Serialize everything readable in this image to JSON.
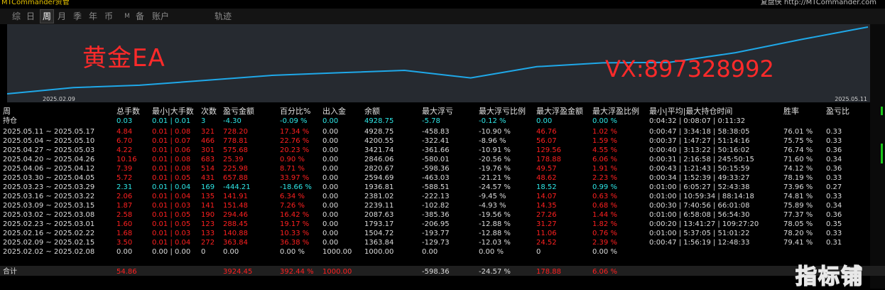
{
  "topbar": {
    "left": "MTCommander资管",
    "right": "复盘侠 http://MTCommander.com"
  },
  "tabs": [
    "综",
    "日",
    "周",
    "月",
    "季",
    "年",
    "币",
    "M",
    "备",
    "账户",
    "轨迹"
  ],
  "active_tab": "周",
  "chart": {
    "watermark_title": "黄金EA",
    "watermark_contact": "VX:897328992",
    "date_left": "2025.02.09",
    "date_right": "2025.05.11",
    "line_color": "#1fa8e8"
  },
  "headers": [
    "周",
    "总手数",
    "最小|大手数",
    "次数",
    "盈亏金额",
    "百分比%",
    "出入金",
    "余额",
    "最大浮亏",
    "最大浮亏比例",
    "最大浮盈金额",
    "最大浮盈比例",
    "最小|平均|最大持仓时间",
    "胜率",
    "盈亏比"
  ],
  "holding": {
    "label": "持仓",
    "lots": "0.03",
    "minmax": "0.01 | 0.01",
    "count": "3",
    "pnl": "-4.30",
    "pct": "-0.09 %",
    "flow": "0.00",
    "balance": "4928.75",
    "maxdd": "-5.78",
    "maxddpct": "-0.12 %",
    "maxfp": "0.00",
    "maxfppct": "0.00 %",
    "hold": "0:04:32 | 0:08:07 | 0:11:32",
    "win": "",
    "ratio": ""
  },
  "rows": [
    {
      "week": "2025.05.11 ~ 2025.05.17",
      "lots": "4.84",
      "minmax": "0.01 | 0.08",
      "count": "321",
      "pnl": "728.20",
      "pct": "17.34 %",
      "flow": "0.00",
      "balance": "4928.75",
      "maxdd": "-458.83",
      "maxddpct": "-10.90 %",
      "maxfp": "46.76",
      "maxfppct": "1.02 %",
      "hold": "0:00:47 | 3:34:18 | 58:38:05",
      "win": "76.01 %",
      "ratio": "0.33",
      "tone": "red"
    },
    {
      "week": "2025.05.04 ~ 2025.05.10",
      "lots": "6.70",
      "minmax": "0.01 | 0.07",
      "count": "466",
      "pnl": "778.81",
      "pct": "22.76 %",
      "flow": "0.00",
      "balance": "4200.55",
      "maxdd": "-322.41",
      "maxddpct": "-8.96 %",
      "maxfp": "56.07",
      "maxfppct": "1.59 %",
      "hold": "0:00:37 | 1:47:27 | 51:14:16",
      "win": "75.75 %",
      "ratio": "0.33",
      "tone": "red"
    },
    {
      "week": "2025.04.27 ~ 2025.05.03",
      "lots": "4.22",
      "minmax": "0.01 | 0.06",
      "count": "301",
      "pnl": "575.68",
      "pct": "20.23 %",
      "flow": "0.00",
      "balance": "3421.74",
      "maxdd": "-361.66",
      "maxddpct": "-10.91 %",
      "maxfp": "129.56",
      "maxfppct": "4.55 %",
      "hold": "0:00:40 | 3:13:22 | 50:16:02",
      "win": "76.74 %",
      "ratio": "0.36",
      "tone": "red"
    },
    {
      "week": "2025.04.20 ~ 2025.04.26",
      "lots": "10.16",
      "minmax": "0.01 | 0.08",
      "count": "683",
      "pnl": "25.39",
      "pct": "0.90 %",
      "flow": "0.00",
      "balance": "2846.06",
      "maxdd": "-580.01",
      "maxddpct": "-20.56 %",
      "maxfp": "178.88",
      "maxfppct": "6.06 %",
      "hold": "0:00:31 | 2:16:58 | 245:50:15",
      "win": "71.60 %",
      "ratio": "0.34",
      "tone": "red"
    },
    {
      "week": "2025.04.06 ~ 2025.04.12",
      "lots": "7.39",
      "minmax": "0.01 | 0.08",
      "count": "514",
      "pnl": "225.98",
      "pct": "8.71 %",
      "flow": "0.00",
      "balance": "2820.67",
      "maxdd": "-598.36",
      "maxddpct": "-19.76 %",
      "maxfp": "49.57",
      "maxfppct": "1.91 %",
      "hold": "0:00:43 | 1:21:43 | 50:15:59",
      "win": "74.12 %",
      "ratio": "0.36",
      "tone": "red"
    },
    {
      "week": "2025.03.30 ~ 2025.04.05",
      "lots": "5.72",
      "minmax": "0.01 | 0.05",
      "count": "431",
      "pnl": "657.88",
      "pct": "33.97 %",
      "flow": "0.00",
      "balance": "2594.69",
      "maxdd": "-463.03",
      "maxddpct": "-21.21 %",
      "maxfp": "48.62",
      "maxfppct": "2.23 %",
      "hold": "0:00:34 | 1:52:39 | 49:33:27",
      "win": "78.19 %",
      "ratio": "0.33",
      "tone": "red"
    },
    {
      "week": "2025.03.23 ~ 2025.03.29",
      "lots": "2.31",
      "minmax": "0.01 | 0.04",
      "count": "169",
      "pnl": "-444.21",
      "pct": "-18.66 %",
      "flow": "0.00",
      "balance": "1936.81",
      "maxdd": "-588.51",
      "maxddpct": "-24.57 %",
      "maxfp": "18.52",
      "maxfppct": "0.99 %",
      "hold": "0:01:00 | 6:05:27 | 52:43:38",
      "win": "73.96 %",
      "ratio": "0.27",
      "tone": "cyan"
    },
    {
      "week": "2025.03.16 ~ 2025.03.22",
      "lots": "2.06",
      "minmax": "0.01 | 0.04",
      "count": "135",
      "pnl": "141.91",
      "pct": "6.34 %",
      "flow": "0.00",
      "balance": "2381.02",
      "maxdd": "-222.13",
      "maxddpct": "-9.45 %",
      "maxfp": "14.07",
      "maxfppct": "0.63 %",
      "hold": "0:01:00 | 10:59:34 | 88:14:18",
      "win": "74.81 %",
      "ratio": "0.33",
      "tone": "red"
    },
    {
      "week": "2025.03.09 ~ 2025.03.15",
      "lots": "1.87",
      "minmax": "0.01 | 0.03",
      "count": "141",
      "pnl": "151.48",
      "pct": "7.26 %",
      "flow": "0.00",
      "balance": "2239.11",
      "maxdd": "-102.82",
      "maxddpct": "-4.93 %",
      "maxfp": "14.35",
      "maxfppct": "0.68 %",
      "hold": "0:00:30 | 7:40:56 | 66:01:08",
      "win": "75.89 %",
      "ratio": "0.34",
      "tone": "red"
    },
    {
      "week": "2025.03.02 ~ 2025.03.08",
      "lots": "2.58",
      "minmax": "0.01 | 0.05",
      "count": "190",
      "pnl": "294.46",
      "pct": "16.42 %",
      "flow": "0.00",
      "balance": "2087.63",
      "maxdd": "-385.36",
      "maxddpct": "-19.56 %",
      "maxfp": "27.26",
      "maxfppct": "1.44 %",
      "hold": "0:01:00 | 6:58:08 | 56:54:30",
      "win": "77.37 %",
      "ratio": "0.36",
      "tone": "red"
    },
    {
      "week": "2025.02.23 ~ 2025.03.01",
      "lots": "1.60",
      "minmax": "0.01 | 0.05",
      "count": "123",
      "pnl": "288.45",
      "pct": "19.17 %",
      "flow": "0.00",
      "balance": "1793.17",
      "maxdd": "-206.95",
      "maxddpct": "-12.88 %",
      "maxfp": "31.27",
      "maxfppct": "1.82 %",
      "hold": "0:00:20 | 13:41:27 | 109:27:20",
      "win": "78.05 %",
      "ratio": "0.35",
      "tone": "red"
    },
    {
      "week": "2025.02.16 ~ 2025.02.22",
      "lots": "1.68",
      "minmax": "0.01 | 0.03",
      "count": "133",
      "pnl": "140.88",
      "pct": "10.33 %",
      "flow": "0.00",
      "balance": "1504.72",
      "maxdd": "-193.77",
      "maxddpct": "-12.88 %",
      "maxfp": "11.06",
      "maxfppct": "0.76 %",
      "hold": "0:01:00 | 5:37:05 | 51:01:22",
      "win": "78.20 %",
      "ratio": "0.33",
      "tone": "red"
    },
    {
      "week": "2025.02.09 ~ 2025.02.15",
      "lots": "3.50",
      "minmax": "0.01 | 0.04",
      "count": "272",
      "pnl": "363.84",
      "pct": "36.38 %",
      "flow": "0.00",
      "balance": "1363.84",
      "maxdd": "-129.73",
      "maxddpct": "-12.03 %",
      "maxfp": "24.52",
      "maxfppct": "2.39 %",
      "hold": "0:00:47 | 1:56:19 | 12:48:33",
      "win": "79.41 %",
      "ratio": "0.31",
      "tone": "red"
    },
    {
      "week": "2025.02.02 ~ 2025.02.08",
      "lots": "0.00",
      "minmax": "0.00 | 0.00",
      "count": "0",
      "pnl": "0.00",
      "pct": "0.00 %",
      "flow": "1000.00",
      "balance": "1000.00",
      "maxdd": "0.00",
      "maxddpct": "0.00 %",
      "maxfp": "0",
      "maxfppct": "0.00 %",
      "hold": "",
      "win": "",
      "ratio": "",
      "tone": "wht"
    }
  ],
  "total": {
    "label": "合计",
    "lots": "54.86",
    "pnl": "3924.45",
    "pct": "392.44 %",
    "flow": "1000.00",
    "maxdd": "-598.36",
    "maxddpct": "-24.57 %",
    "maxfp": "178.88",
    "maxfppct": "6.06 %"
  },
  "brand": "指标铺"
}
